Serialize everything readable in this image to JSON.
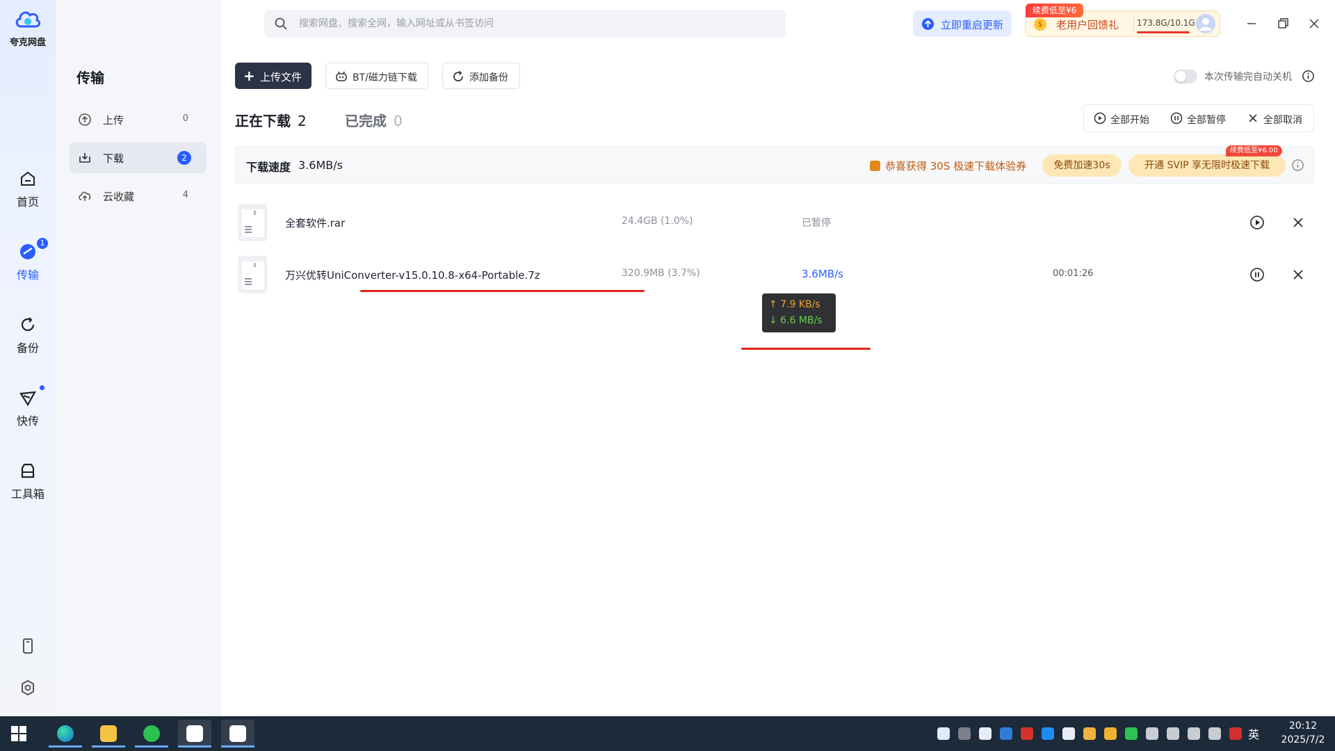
{
  "app": {
    "name": "夸克网盘"
  },
  "rail": {
    "items": [
      {
        "label": "首页",
        "icon": "home-icon"
      },
      {
        "label": "传输",
        "icon": "transfer-icon",
        "badge": "1"
      },
      {
        "label": "备份",
        "icon": "backup-icon"
      },
      {
        "label": "快传",
        "icon": "quick-send-icon"
      },
      {
        "label": "工具箱",
        "icon": "toolbox-icon"
      }
    ],
    "bottom": [
      "phone-icon",
      "settings-icon"
    ]
  },
  "sidebar": {
    "title": "传输",
    "items": [
      {
        "label": "上传",
        "count": "0",
        "icon": "upload-icon"
      },
      {
        "label": "下载",
        "count": "2",
        "icon": "download-icon"
      },
      {
        "label": "云收藏",
        "count": "4",
        "icon": "cloud-save-icon"
      }
    ]
  },
  "search": {
    "placeholder": "搜索网盘、搜索全网，输入网址或从书签访问"
  },
  "header": {
    "update_label": "立即重启更新",
    "promo_tag": "续费低至¥6",
    "promo_label": "老用户回馈礼",
    "quota": "173.8G/10.1G",
    "quota_fill": 1.0
  },
  "toolbar": {
    "upload_label": "上传文件",
    "bt_label": "BT/磁力链下载",
    "backup_label": "添加备份",
    "auto_shutdown_label": "本次传输完自动关机",
    "auto_shutdown_on": false
  },
  "tabs": [
    {
      "label": "正在下载",
      "count": "2"
    },
    {
      "label": "已完成",
      "count": "0"
    }
  ],
  "bulk_actions": {
    "start_all": "全部开始",
    "pause_all": "全部暂停",
    "cancel_all": "全部取消"
  },
  "speed_bar": {
    "title": "下载速度",
    "speed": "3.6MB/s",
    "promo_text": "恭喜获得 30S 极速下载体验券",
    "accel_label": "免费加速30s",
    "svip_label": "开通 SVIP 享无限时极速下载",
    "svip_tag": "续费低至¥6.00"
  },
  "downloads": [
    {
      "name": "全套软件.rar",
      "size": "24.4GB (1.0%)",
      "status": "已暂停",
      "eta": "",
      "action": "play-icon"
    },
    {
      "name": "万兴优转UniConverter-v15.0.10.8-x64-Portable.7z",
      "size": "320.9MB (3.7%)",
      "status": "3.6MB/s",
      "eta": "00:01:26",
      "action": "pause-icon"
    }
  ],
  "tooltip": {
    "up": "↑ 7.9 KB/s",
    "down": "↓ 6.6 MB/s"
  },
  "taskbar": {
    "lang": "英",
    "time": "20:12",
    "date": "2025/7/2"
  },
  "colors": {
    "accent": "#2a5dff",
    "dark": "#2b3346",
    "promo": "#c5471f",
    "annotation": "#e2231a"
  }
}
